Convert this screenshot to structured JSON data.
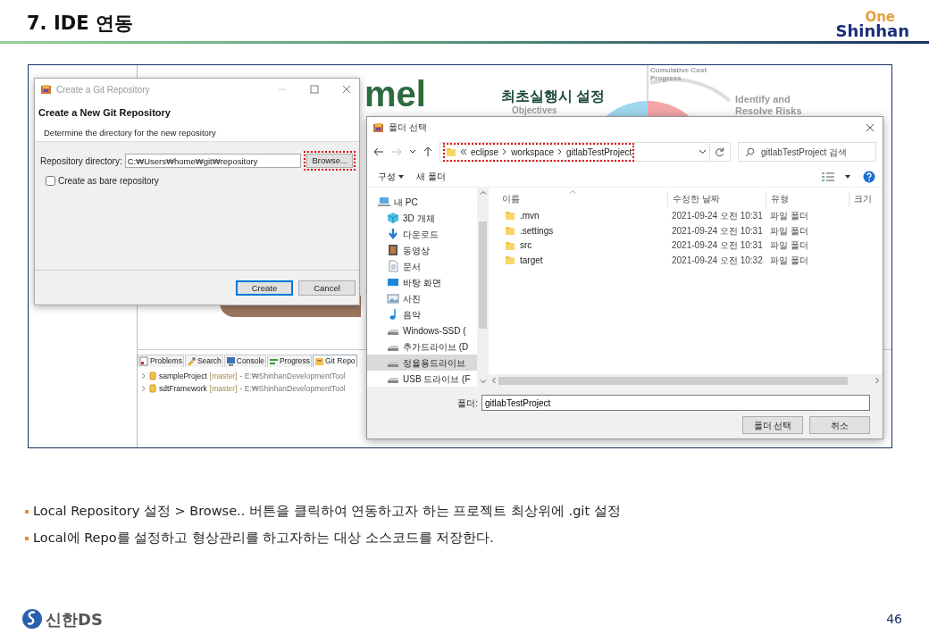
{
  "slide": {
    "title": "7. IDE 연동",
    "logo_top": "One",
    "logo_bottom": "Shinhan"
  },
  "screenshot": {
    "welcome": {
      "banner_text": "mel",
      "heading": "최초실행시 설정",
      "labels": [
        {
          "text": "Objectives"
        },
        {
          "text": "Cumulative Cost\nProgress"
        },
        {
          "text": "Identify and\nResolve Risks"
        }
      ]
    },
    "bottom_panel": {
      "tabs": [
        {
          "label": "Problems",
          "kind": "problems",
          "selected": false
        },
        {
          "label": "Search",
          "kind": "search",
          "selected": false
        },
        {
          "label": "Console",
          "kind": "console",
          "selected": false
        },
        {
          "label": "Progress",
          "kind": "progress",
          "selected": false
        },
        {
          "label": "Git Repo",
          "kind": "git",
          "selected": true
        }
      ],
      "repositories": [
        {
          "name": "sampleProject",
          "branch": "[master]",
          "path": "- E:₩ShinhanDevelopmentTool"
        },
        {
          "name": "sdtFramework",
          "branch": "[master]",
          "path": "- E:₩ShinhanDevelopmentTool"
        }
      ]
    },
    "git_dialog": {
      "title": "Create a Git Repository",
      "heading": "Create a New Git Repository",
      "description": "Determine the directory for the new repository",
      "directory_label": "Repository directory:",
      "directory_value": "C:₩Users₩home₩git₩repository",
      "browse_button": {
        "label": "Browse...",
        "highlighted": true
      },
      "bare_checkbox": {
        "label": "Create as bare repository",
        "checked": false
      },
      "buttons": [
        {
          "label": "Create",
          "default": true
        },
        {
          "label": "Cancel",
          "default": false
        }
      ]
    },
    "folder_dialog": {
      "title": "폴더 선택",
      "breadcrumb": {
        "highlighted": true,
        "segments": [
          "eclipse",
          "workspace",
          "gitlabTestProject"
        ]
      },
      "search": {
        "placeholder": "gitlabTestProject 검색"
      },
      "toolbar": [
        {
          "label": "구성",
          "dropdown": true
        },
        {
          "label": "새 폴더",
          "dropdown": false
        }
      ],
      "nav": [
        {
          "label": "내 PC",
          "kind": "pc",
          "selected": false,
          "children": [
            {
              "label": "3D 개체",
              "kind": "cube",
              "selected": false
            },
            {
              "label": "다운로드",
              "kind": "download",
              "selected": false
            },
            {
              "label": "동영상",
              "kind": "video",
              "selected": false
            },
            {
              "label": "문서",
              "kind": "document",
              "selected": false
            },
            {
              "label": "바탕 화면",
              "kind": "desktop",
              "selected": false
            },
            {
              "label": "사진",
              "kind": "photo",
              "selected": false
            },
            {
              "label": "음악",
              "kind": "music",
              "selected": false
            },
            {
              "label": "Windows-SSD (",
              "kind": "drive",
              "selected": false
            },
            {
              "label": "추가드라이브 (D",
              "kind": "drive",
              "selected": false
            },
            {
              "label": "정율용드라이브",
              "kind": "drive",
              "selected": true
            },
            {
              "label": "USB 드라이브 (F",
              "kind": "drive",
              "selected": false
            }
          ]
        }
      ],
      "columns": [
        {
          "label": "이름",
          "sorted": true
        },
        {
          "label": "수정한 날짜",
          "sorted": false
        },
        {
          "label": "유형",
          "sorted": false
        },
        {
          "label": "크기",
          "sorted": false
        }
      ],
      "rows": [
        {
          "name": ".mvn",
          "modified": "2021-09-24 오전 10:31",
          "type": "파일 폴더"
        },
        {
          "name": ".settings",
          "modified": "2021-09-24 오전 10:31",
          "type": "파일 폴더"
        },
        {
          "name": "src",
          "modified": "2021-09-24 오전 10:31",
          "type": "파일 폴더"
        },
        {
          "name": "target",
          "modified": "2021-09-24 오전 10:32",
          "type": "파일 폴더"
        }
      ],
      "folder_label": "폴더:",
      "folder_value": "gitlabTestProject",
      "buttons": [
        {
          "label": "폴더 선택"
        },
        {
          "label": "취소"
        }
      ]
    }
  },
  "bullets": [
    "Local Repository 설정 >  Browse.. 버튼을 클릭하여 연동하고자 하는 프로젝트 최상위에 .git 설정",
    "Local에 Repo를 설정하고 형상관리를 하고자하는 대상 소스코드를 저장한다."
  ],
  "footer": {
    "logo_text": "신한DS",
    "page_number": "46"
  }
}
